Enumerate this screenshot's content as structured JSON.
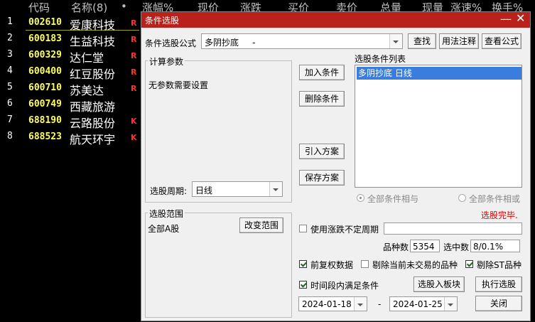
{
  "list_header": {
    "code": "代码",
    "name": "名称(8)",
    "dot": "•",
    "change_pct": "涨幅%",
    "price": "现价",
    "change": "涨跌",
    "bid": "买价",
    "ask": "卖价",
    "volume": "总量",
    "cur_vol": "现量",
    "speed": "涨速%",
    "turnover": "换手%"
  },
  "stocks": [
    {
      "idx": "1",
      "code": "002610",
      "name": "爱康科技",
      "flag": "R"
    },
    {
      "idx": "2",
      "code": "600183",
      "name": "生益科技",
      "flag": "R"
    },
    {
      "idx": "3",
      "code": "600329",
      "name": "达仁堂",
      "flag": "R"
    },
    {
      "idx": "4",
      "code": "600400",
      "name": "红豆股份",
      "flag": "R"
    },
    {
      "idx": "5",
      "code": "600710",
      "name": "苏美达",
      "flag": "R"
    },
    {
      "idx": "6",
      "code": "600749",
      "name": "西藏旅游",
      "flag": ""
    },
    {
      "idx": "7",
      "code": "688190",
      "name": "云路股份",
      "flag": "K"
    },
    {
      "idx": "8",
      "code": "688523",
      "name": "航天环宇",
      "flag": "K"
    }
  ],
  "dialog": {
    "title": "条件选股",
    "min_glyph": "—",
    "close_glyph": "✕",
    "formula_label": "条件选股公式",
    "formula_value": "多阴抄底     -",
    "btn_find": "查找",
    "btn_usage": "用法注释",
    "btn_view": "查看公式",
    "calc_params_label": "计算参数",
    "no_params_text": "无参数需要设置",
    "btn_add": "加入条件",
    "btn_delete": "删除条件",
    "btn_import": "引入方案",
    "btn_save": "保存方案",
    "cond_list_label": "选股条件列表",
    "cond_items": [
      "多阴抄底  日线"
    ],
    "period_label": "选股周期:",
    "period_value": "日线",
    "radio_and": "全部条件相与",
    "radio_or": "全部条件相或",
    "status": "选股完毕.",
    "range_label": "选股范围",
    "range_value": "全部A股",
    "btn_change_range": "改变范围",
    "use_period_label": "使用涨跌不定周期",
    "count_label": "品种数",
    "count_value": "5354",
    "selected_label": "选中数",
    "selected_value": "8/0.1%",
    "fq_label": "前复权数据",
    "exclude_untraded_label": "剔除当前未交易的品种",
    "exclude_st_label": "剔除ST品种",
    "time_range_label": "时间段内满足条件",
    "btn_to_block": "选股入板块",
    "btn_execute": "执行选股",
    "date_from": "2024-01-18",
    "date_sep": "-",
    "date_to": "2024-01-25",
    "btn_close": "关闭"
  },
  "colors": {
    "title_bar": "#b9221a",
    "code_text": "#ffff5a",
    "flag_text": "#ff3030",
    "status_text": "#e00000",
    "selection": "#3a7ddc"
  }
}
